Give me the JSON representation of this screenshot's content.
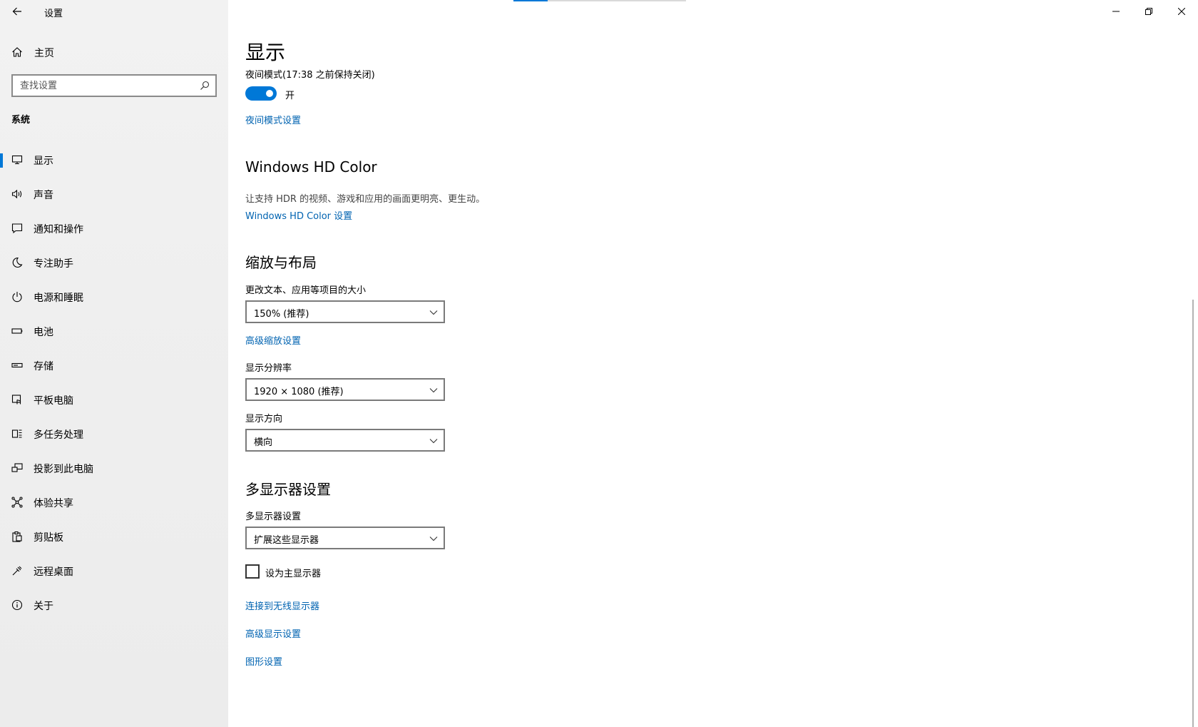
{
  "app": {
    "title": "设置"
  },
  "sidebar": {
    "home_label": "主页",
    "search": {
      "placeholder": "查找设置",
      "value": ""
    },
    "section_title": "系统",
    "items": [
      {
        "label": "显示",
        "icon": "monitor-icon",
        "active": true
      },
      {
        "label": "声音",
        "icon": "speaker-icon"
      },
      {
        "label": "通知和操作",
        "icon": "notification-icon"
      },
      {
        "label": "专注助手",
        "icon": "moon-icon"
      },
      {
        "label": "电源和睡眠",
        "icon": "power-icon"
      },
      {
        "label": "电池",
        "icon": "battery-icon"
      },
      {
        "label": "存储",
        "icon": "storage-icon"
      },
      {
        "label": "平板电脑",
        "icon": "tablet-icon"
      },
      {
        "label": "多任务处理",
        "icon": "multitask-icon"
      },
      {
        "label": "投影到此电脑",
        "icon": "project-icon"
      },
      {
        "label": "体验共享",
        "icon": "share-icon"
      },
      {
        "label": "剪贴板",
        "icon": "clipboard-icon"
      },
      {
        "label": "远程桌面",
        "icon": "remote-icon"
      },
      {
        "label": "关于",
        "icon": "info-icon"
      }
    ]
  },
  "main": {
    "page_title": "显示",
    "night_mode": {
      "status": "夜间模式(17:38 之前保持关闭)",
      "toggle_label": "开",
      "toggle_on": true,
      "settings_link": "夜间模式设置"
    },
    "hd_color": {
      "heading": "Windows HD Color",
      "description": "让支持 HDR 的视频、游戏和应用的画面更明亮、更生动。",
      "link": "Windows HD Color 设置"
    },
    "scale_layout": {
      "heading": "缩放与布局",
      "scale_label": "更改文本、应用等项目的大小",
      "scale_value": "150% (推荐)",
      "advanced_scaling_link": "高级缩放设置",
      "resolution_label": "显示分辨率",
      "resolution_value": "1920 × 1080 (推荐)",
      "orientation_label": "显示方向",
      "orientation_value": "横向"
    },
    "multi_display": {
      "heading": "多显示器设置",
      "label": "多显示器设置",
      "value": "扩展这些显示器",
      "primary_checkbox_label": "设为主显示器",
      "primary_checked": false,
      "wireless_link": "连接到无线显示器",
      "advanced_display_link": "高级显示设置",
      "graphics_link": "图形设置"
    }
  },
  "colors": {
    "accent": "#0078d7",
    "link": "#0063b1",
    "sidebar_bg": "#f2f2f2"
  }
}
